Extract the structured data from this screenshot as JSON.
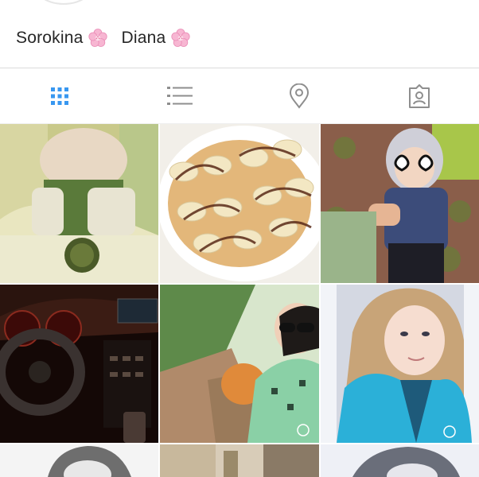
{
  "profile": {
    "first_name": "Sorokina",
    "last_name": "Diana",
    "emoji": "cherry-blossom-icon"
  },
  "tabs": [
    {
      "name": "grid-view",
      "icon": "grid-icon",
      "active": true
    },
    {
      "name": "list-view",
      "icon": "list-icon",
      "active": false
    },
    {
      "name": "places",
      "icon": "location-pin-icon",
      "active": false
    },
    {
      "name": "tagged",
      "icon": "tagged-user-icon",
      "active": false
    }
  ],
  "colors": {
    "active_tab": "#3897f0",
    "inactive_tab": "#8e8e8e",
    "text": "#262626",
    "divider": "#dbdbdb"
  },
  "posts": [
    {
      "subject": "baby-in-high-chair",
      "row": 1,
      "col": 1
    },
    {
      "subject": "pancakes-with-banana",
      "row": 1,
      "col": 2
    },
    {
      "subject": "child-with-heart-sunglasses",
      "row": 1,
      "col": 3
    },
    {
      "subject": "car-dashboard-at-night",
      "row": 2,
      "col": 1
    },
    {
      "subject": "selfie-with-sunglasses",
      "row": 2,
      "col": 2
    },
    {
      "subject": "girl-in-blue-jacket",
      "row": 2,
      "col": 3
    },
    {
      "subject": "portrait",
      "row": 3,
      "col": 1
    },
    {
      "subject": "photo",
      "row": 3,
      "col": 2
    },
    {
      "subject": "portrait",
      "row": 3,
      "col": 3
    }
  ]
}
